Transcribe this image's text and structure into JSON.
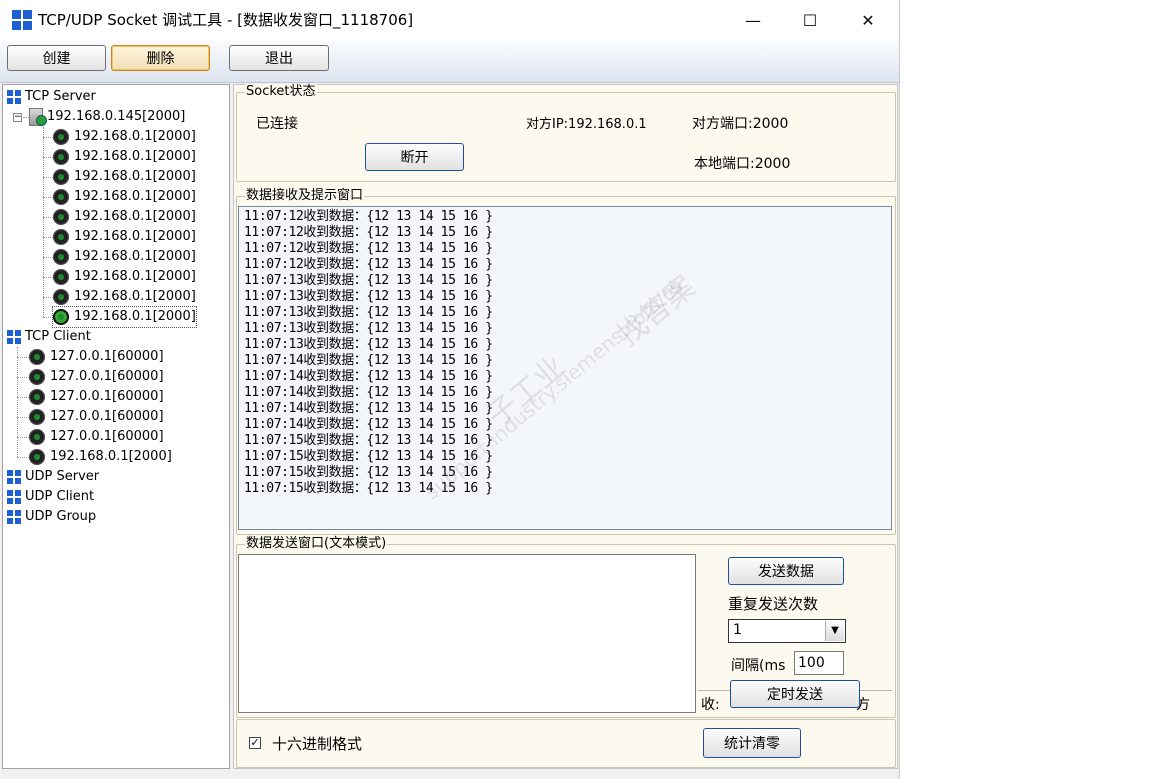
{
  "window": {
    "title": "TCP/UDP Socket 调试工具 - [数据收发窗口_1118706]",
    "minimize": "—",
    "maximize": "☐",
    "close": "✕"
  },
  "toolbar": {
    "create": "创建",
    "delete": "删除",
    "exit": "退出"
  },
  "tree": {
    "tcp_server": "TCP Server",
    "server_node": "192.168.0.145[2000]",
    "server_children": [
      "192.168.0.1[2000]",
      "192.168.0.1[2000]",
      "192.168.0.1[2000]",
      "192.168.0.1[2000]",
      "192.168.0.1[2000]",
      "192.168.0.1[2000]",
      "192.168.0.1[2000]",
      "192.168.0.1[2000]",
      "192.168.0.1[2000]",
      "192.168.0.1[2000]"
    ],
    "tcp_client": "TCP Client",
    "client_children": [
      "127.0.0.1[60000]",
      "127.0.0.1[60000]",
      "127.0.0.1[60000]",
      "127.0.0.1[60000]",
      "127.0.0.1[60000]",
      "192.168.0.1[2000]"
    ],
    "udp_server": "UDP Server",
    "udp_client": "UDP Client",
    "udp_group": "UDP Group"
  },
  "socket": {
    "group_label": "Socket状态",
    "state": "已连接",
    "peer_ip": "对方IP:192.168.0.1",
    "peer_port": "对方端口:2000",
    "local_port": "本地端口:2000",
    "disconnect": "断开"
  },
  "recv": {
    "group_label": "数据接收及提示窗口",
    "lines": [
      "11:07:12收到数据：{12 13 14 15 16 }",
      "11:07:12收到数据：{12 13 14 15 16 }",
      "11:07:12收到数据：{12 13 14 15 16 }",
      "11:07:12收到数据：{12 13 14 15 16 }",
      "11:07:13收到数据：{12 13 14 15 16 }",
      "11:07:13收到数据：{12 13 14 15 16 }",
      "11:07:13收到数据：{12 13 14 15 16 }",
      "11:07:13收到数据：{12 13 14 15 16 }",
      "11:07:13收到数据：{12 13 14 15 16 }",
      "11:07:14收到数据：{12 13 14 15 16 }",
      "11:07:14收到数据：{12 13 14 15 16 }",
      "11:07:14收到数据：{12 13 14 15 16 }",
      "11:07:14收到数据：{12 13 14 15 16 }",
      "11:07:14收到数据：{12 13 14 15 16 }",
      "11:07:15收到数据：{12 13 14 15 16 }",
      "11:07:15收到数据：{12 13 14 15 16 }",
      "11:07:15收到数据：{12 13 14 15 16 }",
      "11:07:15收到数据：{12 13 14 15 16 }"
    ],
    "watermark_1": "找答案",
    "watermark_2": "子工业",
    "watermark_3": "support.industry.siemens.com/cs"
  },
  "send": {
    "group_label": "数据发送窗口(文本模式)",
    "send_button": "发送数据",
    "repeat_label": "重复发送次数",
    "repeat_value": "1",
    "interval_label": "间隔(ms",
    "interval_value": "100",
    "timer_button": "定时发送",
    "recv_label": "收:",
    "status_tail": "方"
  },
  "bottom": {
    "hex_check": "✓",
    "hex_label": "十六进制格式",
    "clear_button": "统计清零"
  }
}
